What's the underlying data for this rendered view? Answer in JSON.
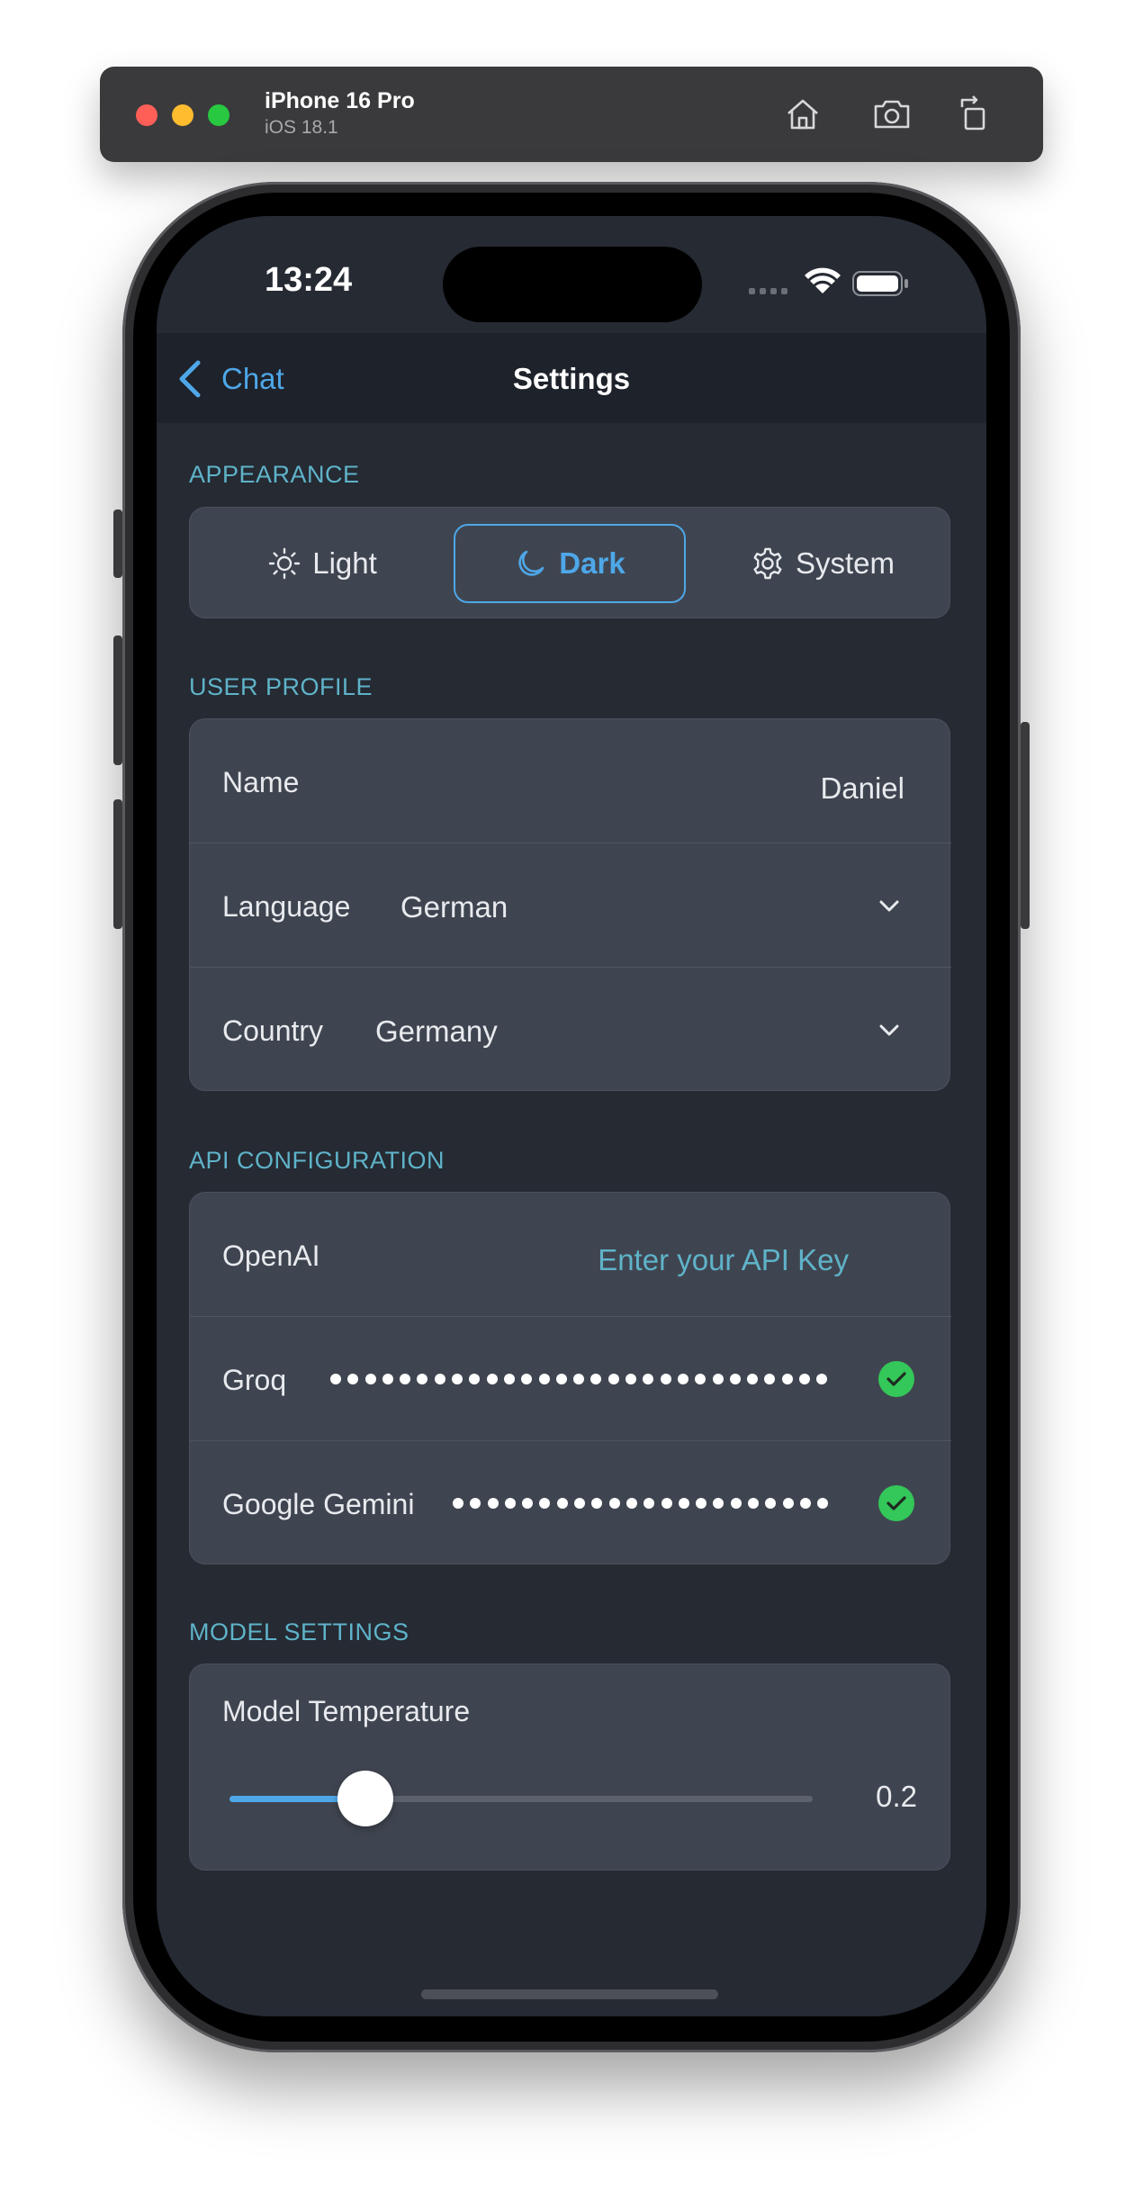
{
  "simulator": {
    "device_name": "iPhone 16 Pro",
    "os_version": "iOS 18.1",
    "toolbar_icons": [
      "home-icon",
      "screenshot-icon",
      "rotate-icon"
    ]
  },
  "status_bar": {
    "time": "13:24",
    "icons": [
      "cellular-icon",
      "wifi-icon",
      "battery-icon"
    ]
  },
  "nav": {
    "back_label": "Chat",
    "title": "Settings"
  },
  "appearance": {
    "header": "APPEARANCE",
    "options": [
      {
        "label": "Light",
        "icon": "sun-icon",
        "selected": false
      },
      {
        "label": "Dark",
        "icon": "moon-icon",
        "selected": true
      },
      {
        "label": "System",
        "icon": "gear-icon",
        "selected": false
      }
    ]
  },
  "user_profile": {
    "header": "USER PROFILE",
    "name_label": "Name",
    "name_value": "Daniel",
    "language_label": "Language",
    "language_value": "German",
    "country_label": "Country",
    "country_value": "Germany"
  },
  "api_configuration": {
    "header": "API CONFIGURATION",
    "openai_label": "OpenAI",
    "openai_placeholder": "Enter your API Key",
    "groq_label": "Groq",
    "groq_verified": true,
    "gemini_label": "Google Gemini",
    "gemini_verified": true
  },
  "model_settings": {
    "header": "MODEL SETTINGS",
    "temperature_label": "Model Temperature",
    "temperature_value": "0.2",
    "temperature_fraction": 0.2
  },
  "colors": {
    "accent": "#4ea7e8",
    "section_header": "#5fb3c9",
    "background": "#252a33",
    "card": "#3f4550",
    "success": "#34c759"
  }
}
